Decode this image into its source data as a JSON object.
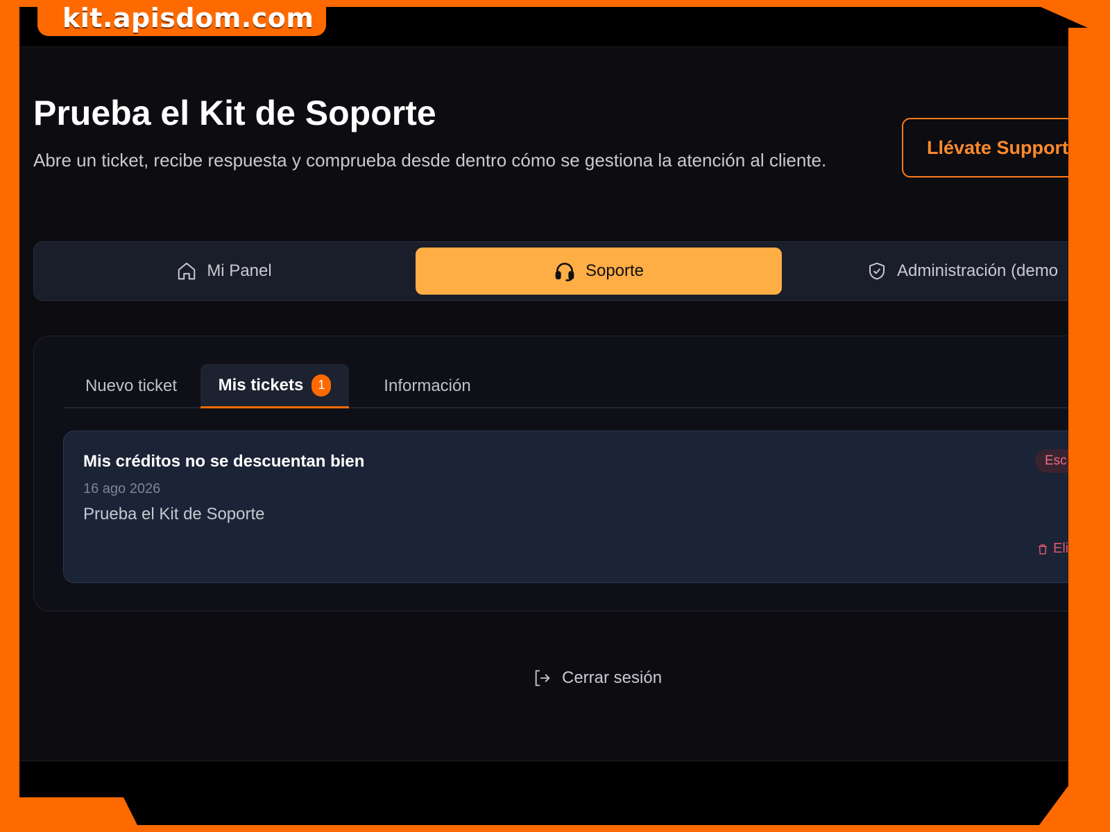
{
  "brand": {
    "domain": "kit.apisdom.com"
  },
  "header": {
    "title": "Prueba el Kit de Soporte",
    "subtitle": "Abre un ticket, recibe respuesta y comprueba desde dentro cómo se gestiona la atención al cliente.",
    "cta_label": "Llévate Support Ki"
  },
  "nav": {
    "items": [
      {
        "label": "Mi Panel",
        "icon": "home-icon"
      },
      {
        "label": "Soporte",
        "icon": "headset-icon",
        "active": true
      },
      {
        "label": "Administración (demo",
        "icon": "shield-check-icon"
      }
    ]
  },
  "tabs": {
    "nuevo": "Nuevo ticket",
    "mis": "Mis tickets",
    "mis_count": "1",
    "info": "Información"
  },
  "ticket": {
    "title": "Mis créditos no se descuentan bien",
    "date": "16 ago 2026",
    "description": "Prueba el Kit de Soporte",
    "status": "Esc",
    "delete_label": "Eli"
  },
  "footer": {
    "logout_label": "Cerrar sesión"
  },
  "colors": {
    "frame": "#ff6a00",
    "accent": "#ffad45",
    "background": "#0c0c11",
    "card": "#1b2436",
    "danger": "#e0566f"
  }
}
